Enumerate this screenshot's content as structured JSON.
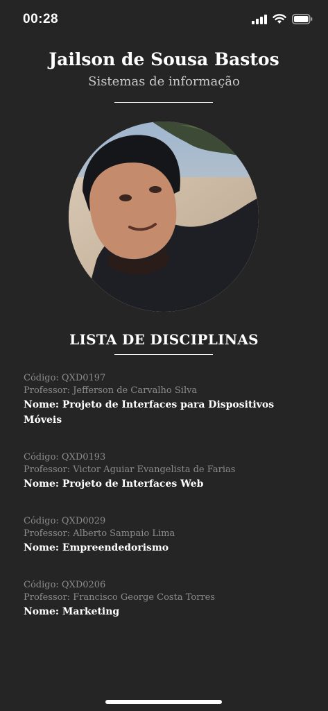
{
  "status_bar": {
    "time": "00:28"
  },
  "profile": {
    "name": "Jailson de Sousa Bastos",
    "course": "Sistemas de informação"
  },
  "section_title": "LISTA DE DISCIPLINAS",
  "courses": [
    {
      "code": "Código: QXD0197",
      "professor": "Professor: Jefferson de Carvalho Silva",
      "name": "Nome: Projeto de Interfaces para Dispositivos Móveis"
    },
    {
      "code": "Código: QXD0193",
      "professor": "Professor: Victor Aguiar Evangelista de Farias",
      "name": "Nome: Projeto de Interfaces Web"
    },
    {
      "code": "Código: QXD0029",
      "professor": "Professor: Alberto Sampaio Lima",
      "name": "Nome: Empreendedorismo"
    },
    {
      "code": "Código: QXD0206",
      "professor": "Professor: Francisco George Costa Torres",
      "name": "Nome: Marketing"
    }
  ],
  "icons": {
    "signal": "cellular-signal-icon",
    "wifi": "wifi-icon",
    "battery": "battery-icon"
  }
}
